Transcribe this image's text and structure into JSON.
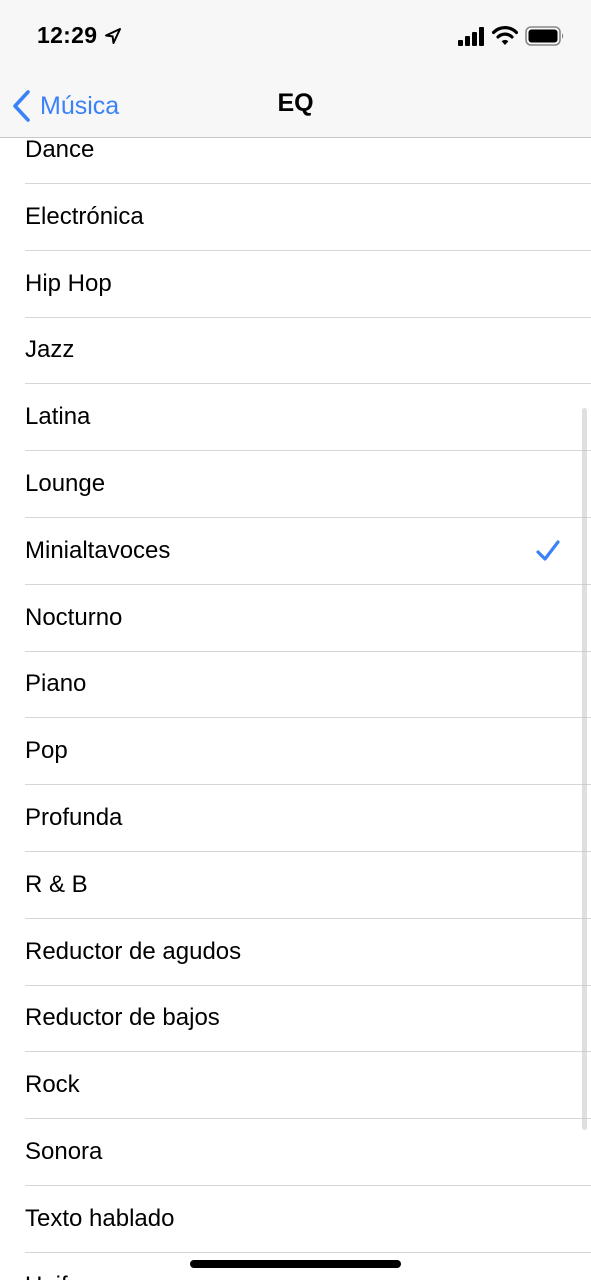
{
  "status_bar": {
    "time": "12:29",
    "icons": [
      "location-arrow-icon",
      "cellular-signal-icon",
      "wifi-icon",
      "battery-icon"
    ]
  },
  "nav": {
    "back_label": "Música",
    "title": "EQ",
    "accent_color": "#3a82f7"
  },
  "eq_list": {
    "selected": "Minialtavoces",
    "items": [
      {
        "label": "Dance"
      },
      {
        "label": "Electrónica"
      },
      {
        "label": "Hip Hop"
      },
      {
        "label": "Jazz"
      },
      {
        "label": "Latina"
      },
      {
        "label": "Lounge"
      },
      {
        "label": "Minialtavoces"
      },
      {
        "label": "Nocturno"
      },
      {
        "label": "Piano"
      },
      {
        "label": "Pop"
      },
      {
        "label": "Profunda"
      },
      {
        "label": "R & B"
      },
      {
        "label": "Reductor de agudos"
      },
      {
        "label": "Reductor de bajos"
      },
      {
        "label": "Rock"
      },
      {
        "label": "Sonora"
      },
      {
        "label": "Texto hablado"
      },
      {
        "label": "Uniforme"
      }
    ]
  }
}
